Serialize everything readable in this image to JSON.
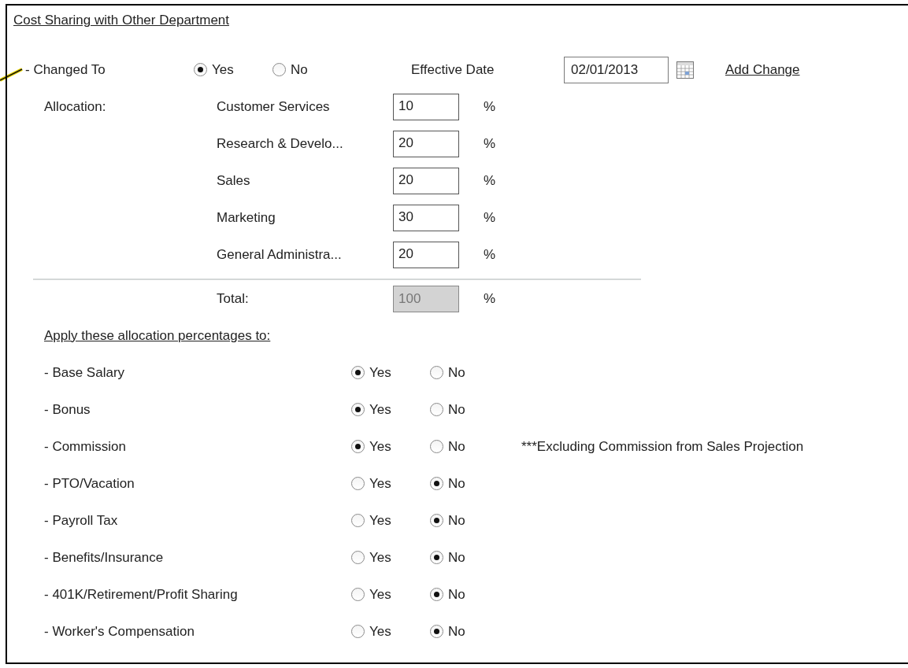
{
  "section_title": "Cost Sharing with Other Department",
  "changed_to": {
    "label": "- Changed To",
    "options": [
      {
        "label": "Yes",
        "selected": true
      },
      {
        "label": "No",
        "selected": false
      }
    ]
  },
  "effective_date": {
    "label": "Effective Date",
    "value": "02/01/2013"
  },
  "add_change": "Add Change",
  "allocation": {
    "label": "Allocation:",
    "rows": [
      {
        "name": "Customer Services",
        "value": "10",
        "unit": "%"
      },
      {
        "name": "Research & Develo...",
        "value": "20",
        "unit": "%"
      },
      {
        "name": "Sales",
        "value": "20",
        "unit": "%"
      },
      {
        "name": "Marketing",
        "value": "30",
        "unit": "%"
      },
      {
        "name": "General Administra...",
        "value": "20",
        "unit": "%"
      }
    ],
    "total": {
      "label": "Total:",
      "value": "100",
      "unit": "%",
      "disabled": true
    }
  },
  "apply": {
    "heading": "Apply these allocation percentages to:",
    "items": [
      {
        "label": "- Base Salary",
        "options": [
          {
            "label": "Yes",
            "selected": true
          },
          {
            "label": "No",
            "selected": false
          }
        ]
      },
      {
        "label": "- Bonus",
        "options": [
          {
            "label": "Yes",
            "selected": true
          },
          {
            "label": "No",
            "selected": false
          }
        ]
      },
      {
        "label": "- Commission",
        "options": [
          {
            "label": "Yes",
            "selected": true
          },
          {
            "label": "No",
            "selected": false
          }
        ],
        "note": "***Excluding Commission from Sales Projection"
      },
      {
        "label": "- PTO/Vacation",
        "options": [
          {
            "label": "Yes",
            "selected": false
          },
          {
            "label": "No",
            "selected": true
          }
        ]
      },
      {
        "label": "- Payroll Tax",
        "options": [
          {
            "label": "Yes",
            "selected": false
          },
          {
            "label": "No",
            "selected": true
          }
        ]
      },
      {
        "label": "- Benefits/Insurance",
        "options": [
          {
            "label": "Yes",
            "selected": false
          },
          {
            "label": "No",
            "selected": true
          }
        ]
      },
      {
        "label": "- 401K/Retirement/Profit Sharing",
        "options": [
          {
            "label": "Yes",
            "selected": false
          },
          {
            "label": "No",
            "selected": true
          }
        ]
      },
      {
        "label": "- Worker's Compensation",
        "options": [
          {
            "label": "Yes",
            "selected": false
          },
          {
            "label": "No",
            "selected": true
          }
        ]
      }
    ]
  }
}
